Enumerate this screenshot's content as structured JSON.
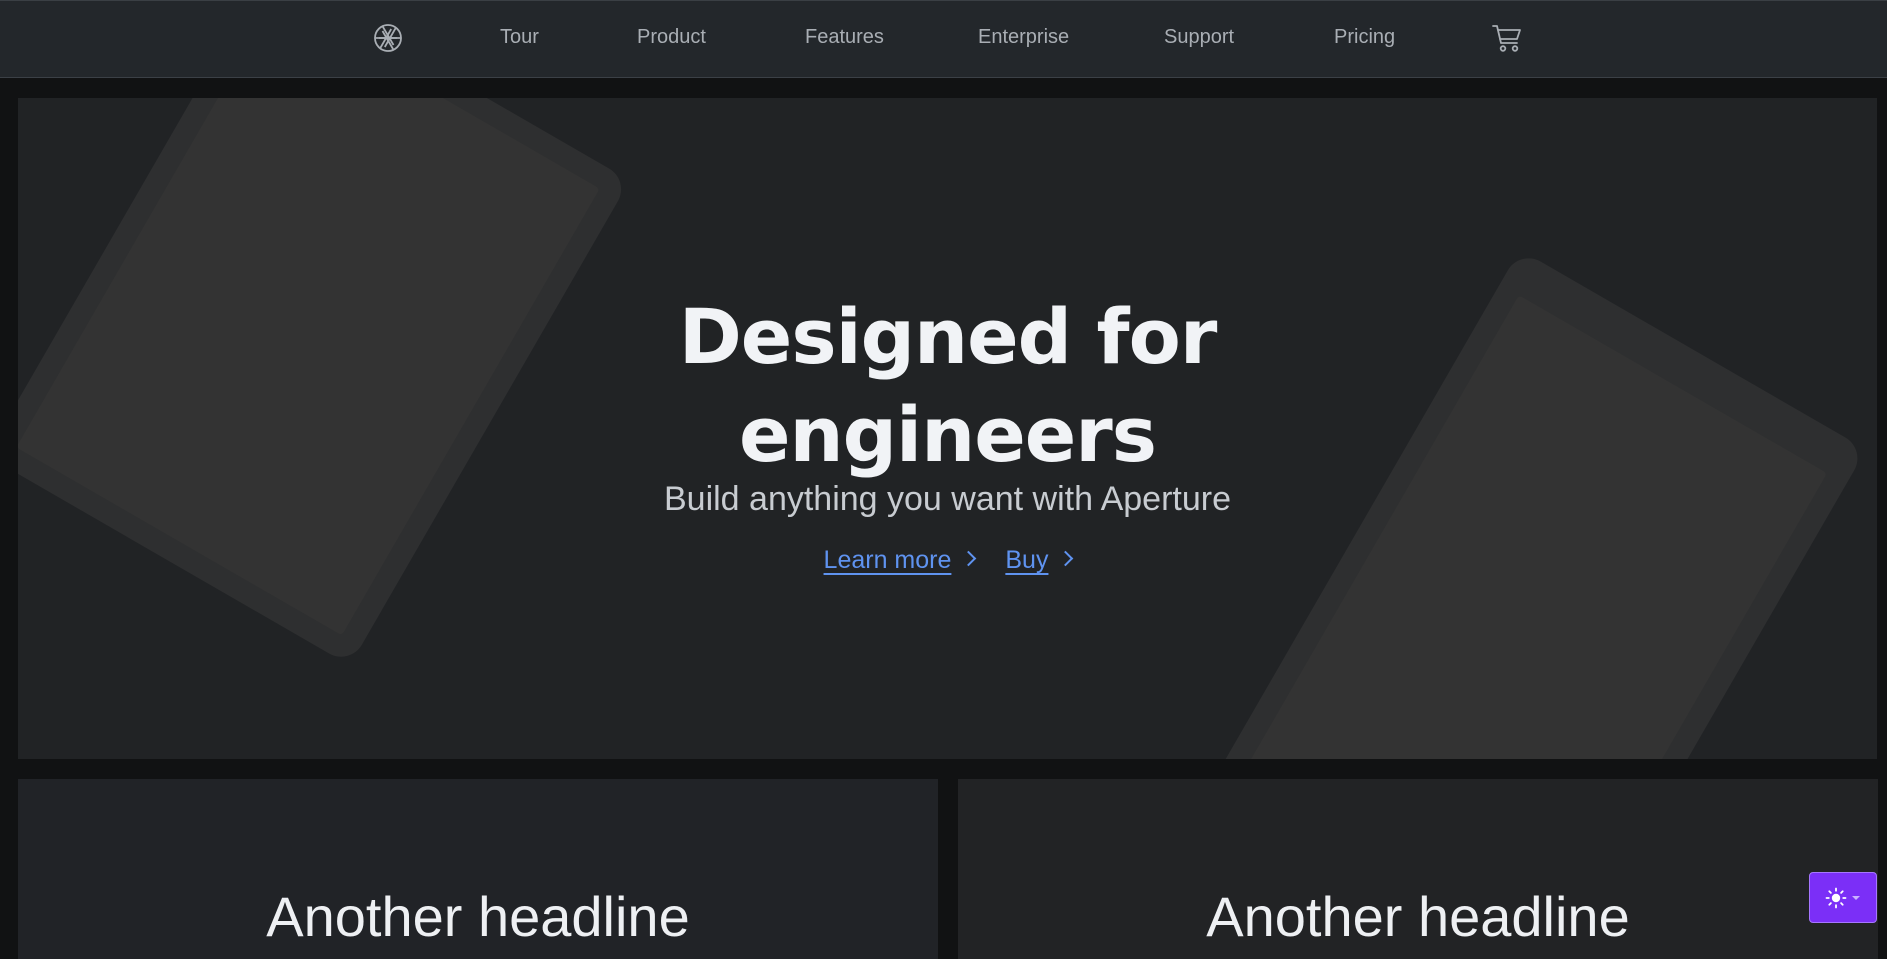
{
  "navbar": {
    "logo_icon": "aperture-icon",
    "links": [
      {
        "label": "Tour"
      },
      {
        "label": "Product"
      },
      {
        "label": "Features"
      },
      {
        "label": "Enterprise"
      },
      {
        "label": "Support"
      },
      {
        "label": "Pricing"
      }
    ],
    "cart_icon": "cart-icon"
  },
  "hero": {
    "title_line1": "Designed for",
    "title_line2": "engineers",
    "subtitle": "Build anything you want with Aperture",
    "learn_more_label": "Learn more",
    "buy_label": "Buy",
    "link_color": "#5f93f0"
  },
  "cards": [
    {
      "headline": "Another headline"
    },
    {
      "headline": "Another headline"
    }
  ],
  "theme_toggle": {
    "icon": "sun-icon",
    "color": "#7b2ff7"
  }
}
